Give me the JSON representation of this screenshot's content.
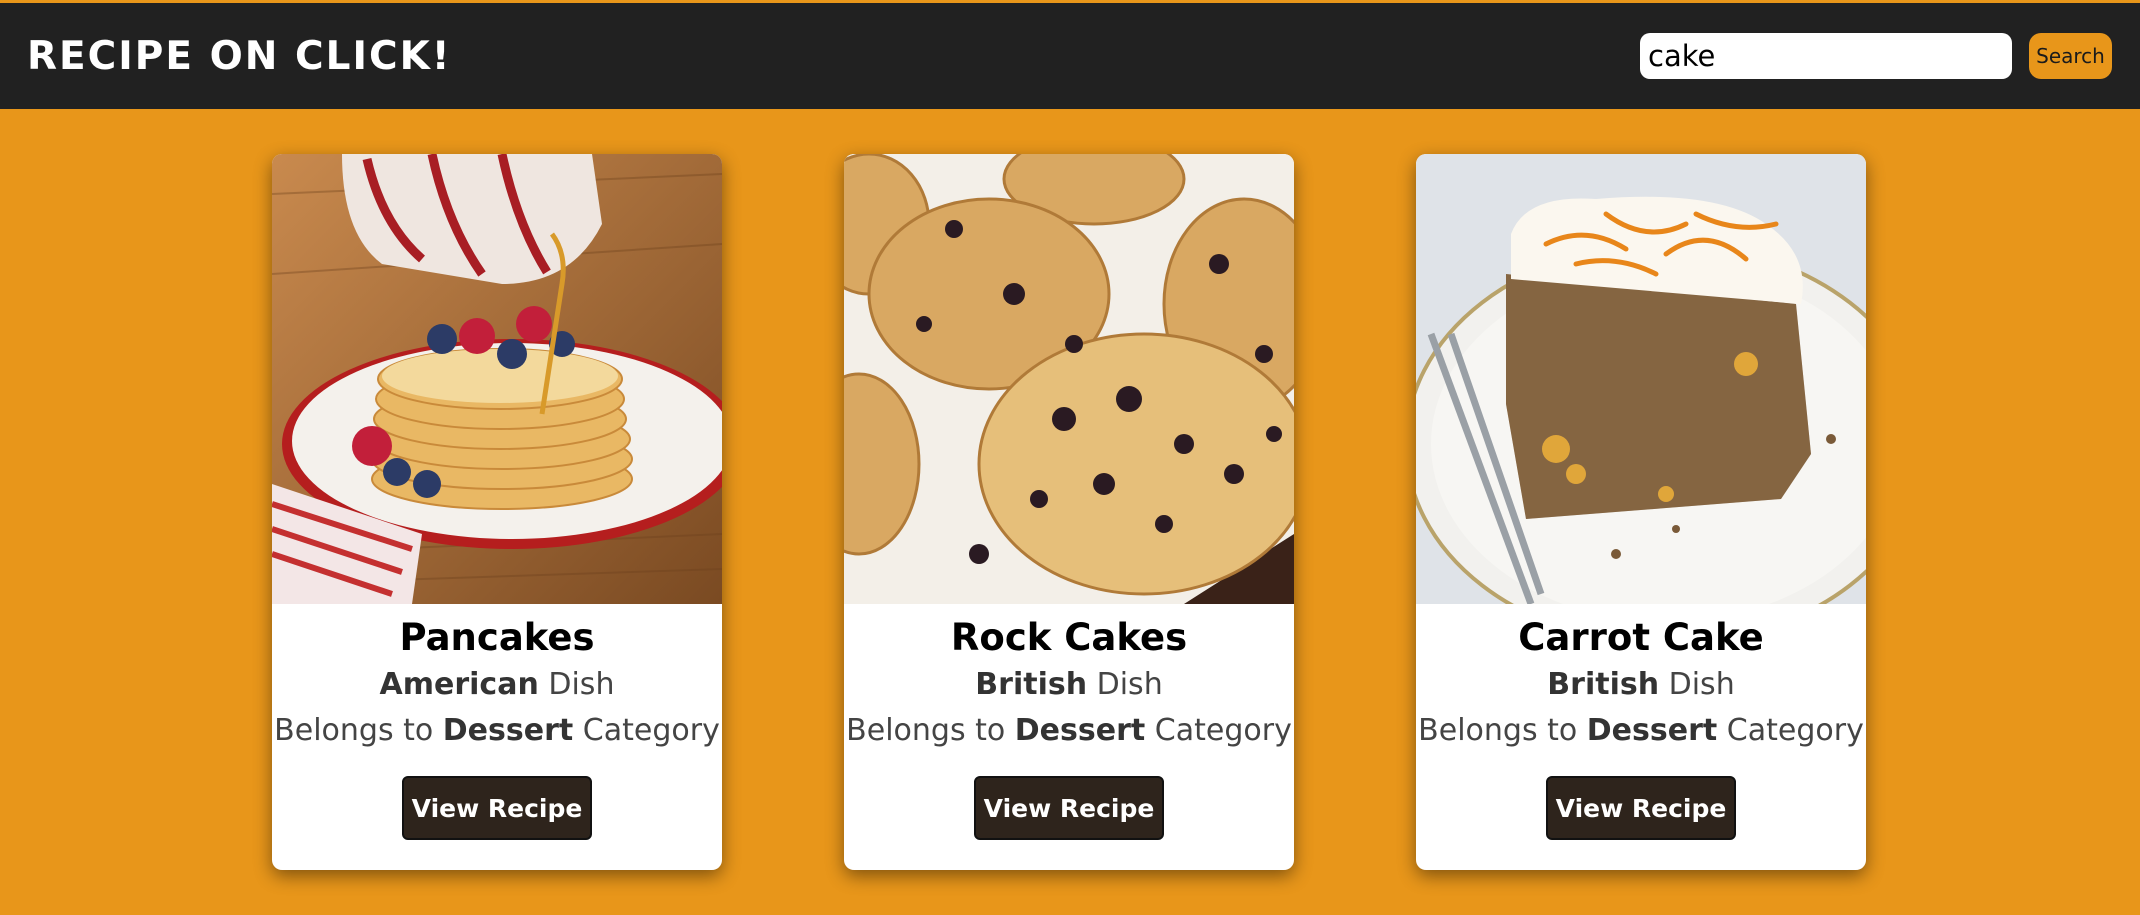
{
  "header": {
    "brand": "RECIPE ON CLICK!",
    "search_value": "cake",
    "search_button": "Search"
  },
  "cards": [
    {
      "title": "Pancakes",
      "area": "American",
      "dish_suffix": "Dish",
      "category_prefix": "Belongs to",
      "category": "Dessert",
      "category_suffix": "Category",
      "button": "View Recipe"
    },
    {
      "title": "Rock Cakes",
      "area": "British",
      "dish_suffix": "Dish",
      "category_prefix": "Belongs to",
      "category": "Dessert",
      "category_suffix": "Category",
      "button": "View Recipe"
    },
    {
      "title": "Carrot Cake",
      "area": "British",
      "dish_suffix": "Dish",
      "category_prefix": "Belongs to",
      "category": "Dessert",
      "category_suffix": "Category",
      "button": "View Recipe"
    }
  ],
  "colors": {
    "background": "#e8961a",
    "header": "#212121",
    "button": "#2e241c"
  }
}
